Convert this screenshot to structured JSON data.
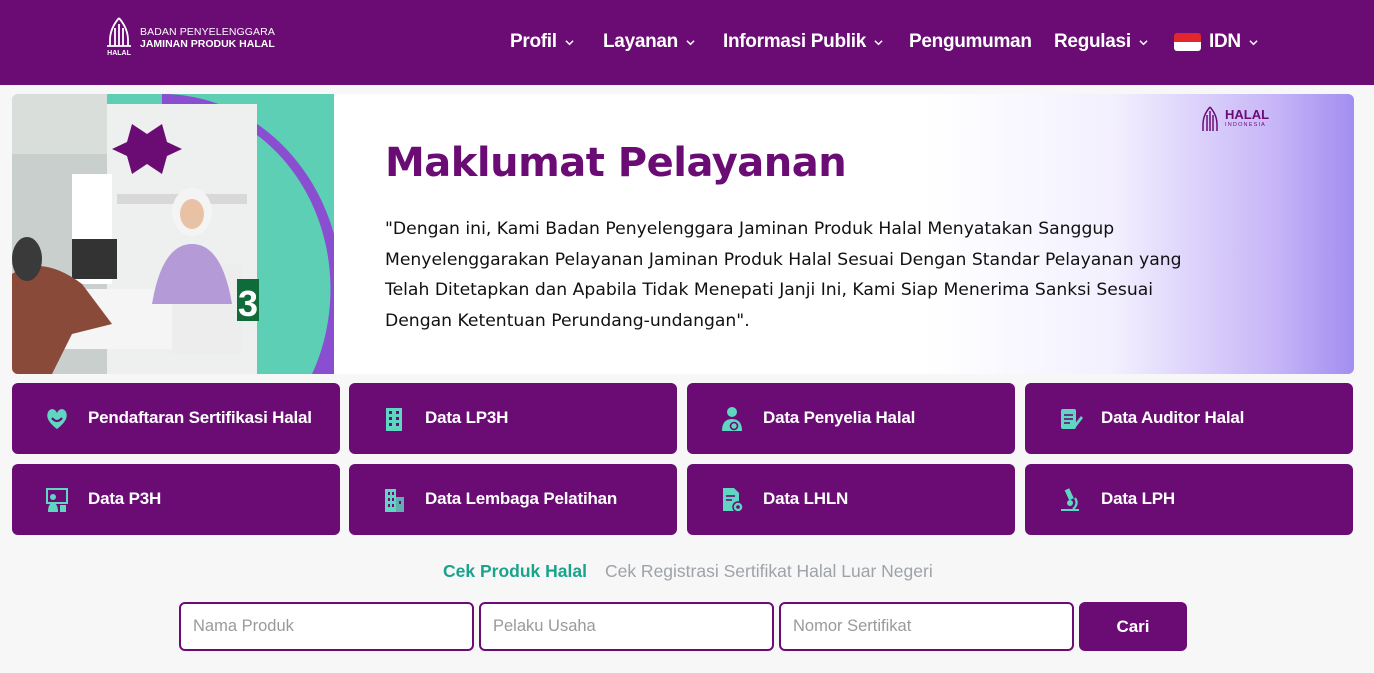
{
  "header": {
    "logo_line1": "BADAN PENYELENGGARA",
    "logo_line2": "JAMINAN PRODUK HALAL",
    "logo_word": "HALAL",
    "nav": [
      {
        "label": "Profil",
        "icon": "chevron-down-icon"
      },
      {
        "label": "Layanan",
        "icon": "chevron-down-icon"
      },
      {
        "label": "Informasi Publik",
        "icon": "chevron-down-icon"
      },
      {
        "label": "Pengumuman"
      },
      {
        "label": "Regulasi",
        "icon": "chevron-down-icon"
      }
    ],
    "language": {
      "label": "IDN",
      "flag": "indonesia-flag-icon"
    }
  },
  "banner": {
    "title": "Maklumat Pelayanan",
    "quote": "\"Dengan ini, Kami Badan Penyelenggara Jaminan Produk Halal Menyatakan Sanggup Menyelenggarakan Pelayanan Jaminan Produk Halal Sesuai Dengan Standar Pelayanan yang Telah Ditetapkan dan Apabila Tidak Menepati Janji Ini, Kami Siap Menerima Sanksi Sesuai Dengan Ketentuan Perundang-undangan\".",
    "badge_title": "HALAL",
    "badge_sub": "INDONESIA",
    "counter_number": "3"
  },
  "tiles": [
    {
      "label": "Pendaftaran Sertifikasi Halal",
      "icon": "heart-hands-icon"
    },
    {
      "label": "Data LP3H",
      "icon": "building-icon"
    },
    {
      "label": "Data Penyelia Halal",
      "icon": "supervisor-icon"
    },
    {
      "label": "Data Auditor Halal",
      "icon": "document-pen-icon"
    },
    {
      "label": "Data P3H",
      "icon": "presenter-icon"
    },
    {
      "label": "Data Lembaga Pelatihan",
      "icon": "office-building-icon"
    },
    {
      "label": "Data LHLN",
      "icon": "document-gear-icon"
    },
    {
      "label": "Data LPH",
      "icon": "microscope-icon"
    }
  ],
  "search": {
    "tabs": [
      "Cek Produk Halal",
      "Cek Registrasi Sertifikat Halal Luar Negeri"
    ],
    "active_tab": 0,
    "fields": [
      {
        "placeholder": "Nama Produk",
        "value": ""
      },
      {
        "placeholder": "Pelaku Usaha",
        "value": ""
      },
      {
        "placeholder": "Nomor Sertifikat",
        "value": ""
      }
    ],
    "button_label": "Cari"
  },
  "colors": {
    "brand_purple": "#6a0c74",
    "accent_teal": "#1aa38b",
    "icon_teal": "#5fd6c2"
  }
}
